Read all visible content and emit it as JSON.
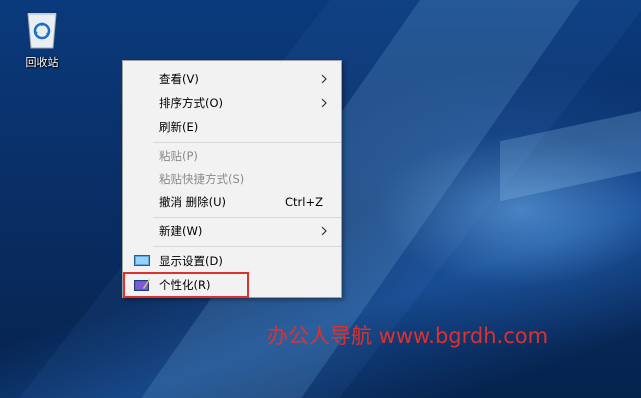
{
  "desktop": {
    "recycle_bin_label": "回收站"
  },
  "context_menu": {
    "items": [
      {
        "label": "查看(V)",
        "submenu": true
      },
      {
        "label": "排序方式(O)",
        "submenu": true
      },
      {
        "label": "刷新(E)"
      },
      {
        "label": "粘贴(P)",
        "disabled": true
      },
      {
        "label": "粘贴快捷方式(S)",
        "disabled": true
      },
      {
        "label": "撤消 删除(U)",
        "shortcut": "Ctrl+Z"
      },
      {
        "label": "新建(W)",
        "submenu": true
      },
      {
        "label": "显示设置(D)",
        "icon": "display-settings-icon"
      },
      {
        "label": "个性化(R)",
        "icon": "personalize-icon",
        "highlighted": true
      }
    ]
  },
  "watermark": {
    "text": "办公人导航  www.bgrdh.com",
    "color": "#e0302e"
  },
  "colors": {
    "menu_background": "#f2f2f2",
    "highlight_border": "#e0302e"
  }
}
